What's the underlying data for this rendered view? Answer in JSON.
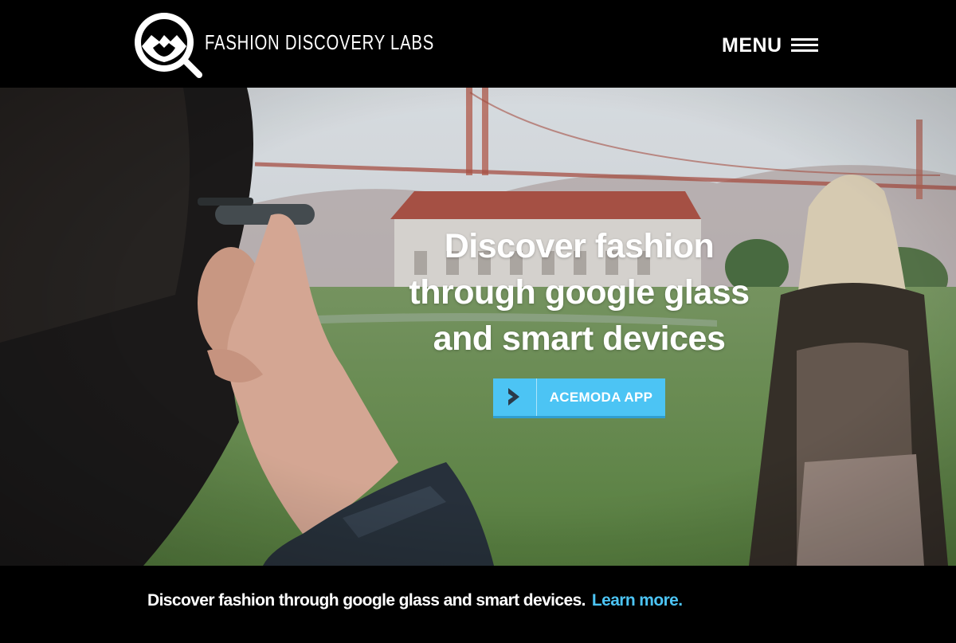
{
  "brand": {
    "name": "FASHION DISCOVERY LABS"
  },
  "nav": {
    "menu_label": "MENU"
  },
  "hero": {
    "title_lines": [
      "Discover fashion",
      "through google glass",
      "and smart devices"
    ],
    "cta_label": "ACEMODA APP",
    "cta_icon": "chevron-right-icon"
  },
  "footer": {
    "text": "Discover fashion through google glass and smart devices.",
    "link_label": "Learn more."
  },
  "colors": {
    "background": "#000000",
    "accent": "#4cc4f4",
    "text": "#ffffff"
  }
}
